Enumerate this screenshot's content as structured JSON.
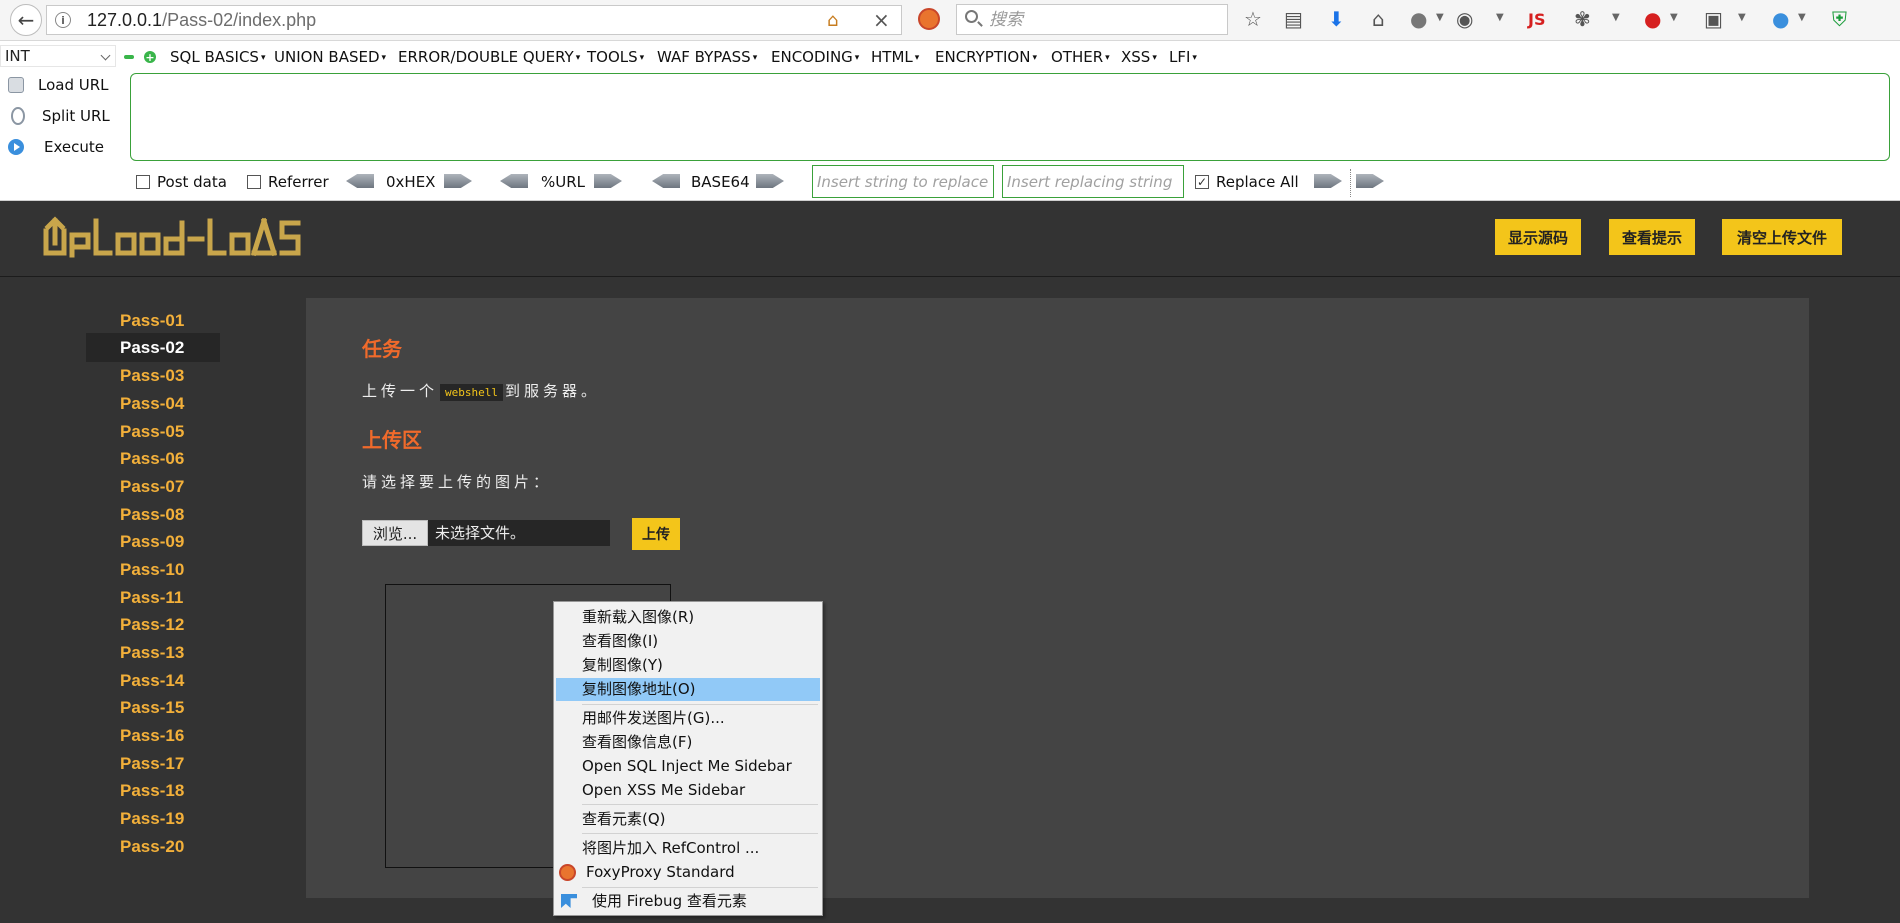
{
  "browser": {
    "url_host": "127.0.0.1",
    "url_path": "/Pass-02/index.php",
    "search_placeholder": "搜索"
  },
  "hackbar": {
    "select_value": "INT",
    "menus": [
      "SQL BASICS",
      "UNION BASED",
      "ERROR/DOUBLE QUERY",
      "TOOLS",
      "WAF BYPASS",
      "ENCODING",
      "HTML",
      "ENCRYPTION",
      "OTHER",
      "XSS",
      "LFI"
    ],
    "load_url": "Load URL",
    "split_url": "Split URL",
    "execute": "Execute",
    "post_data": "Post data",
    "referrer": "Referrer",
    "hex": "0xHEX",
    "url_enc": "%URL",
    "base64": "BASE64",
    "replace_placeholder": "Insert string to replace",
    "replacing_placeholder": "Insert replacing string",
    "replace_all": "Replace All"
  },
  "header": {
    "logo_text": "UpLoad-labS",
    "show_source": "显示源码",
    "show_hint": "查看提示",
    "clear_upload": "清空上传文件"
  },
  "sidebar": {
    "passes": [
      "Pass-01",
      "Pass-02",
      "Pass-03",
      "Pass-04",
      "Pass-05",
      "Pass-06",
      "Pass-07",
      "Pass-08",
      "Pass-09",
      "Pass-10",
      "Pass-11",
      "Pass-12",
      "Pass-13",
      "Pass-14",
      "Pass-15",
      "Pass-16",
      "Pass-17",
      "Pass-18",
      "Pass-19",
      "Pass-20"
    ],
    "active_index": 1
  },
  "main": {
    "task_title": "任务",
    "task_prefix": "上传一个",
    "task_code": "webshell",
    "task_suffix": "到服务器。",
    "upload_title": "上传区",
    "choose_label": "请选择要上传的图片：",
    "browse_label": "浏览...",
    "file_status": "未选择文件。",
    "upload_label": "上传"
  },
  "context_menu": {
    "items": [
      "重新载入图像(R)",
      "查看图像(I)",
      "复制图像(Y)",
      "复制图像地址(O)",
      "用邮件发送图片(G)...",
      "查看图像信息(F)",
      "Open SQL Inject Me Sidebar",
      "Open XSS Me Sidebar",
      "查看元素(Q)",
      "将图片加入 RefControl ...",
      "FoxyProxy Standard",
      "使用 Firebug 查看元素"
    ],
    "highlighted_index": 3
  },
  "colors": {
    "accent_yellow": "#f3c51a",
    "pass_orange": "#f3b03a",
    "heading_orange": "#f06a2b",
    "page_bg": "#333333",
    "panel_bg": "#444444",
    "menu_highlight": "#91c9f7"
  }
}
